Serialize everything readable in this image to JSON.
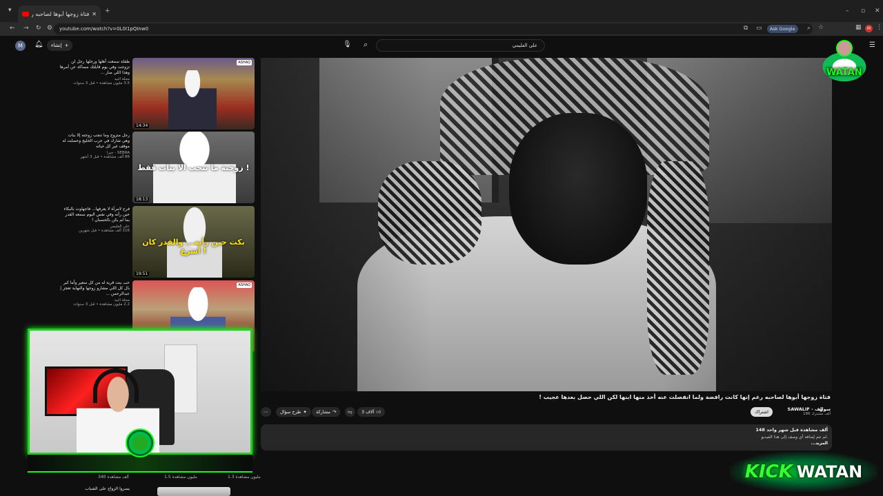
{
  "browser": {
    "tab_title": "فتاة زوجها أبوها لصاحبه رغم",
    "url": "youtube.com/watch?v=0L0I1pQInw0",
    "ask_google": "Ask Google",
    "profile_letter": "M"
  },
  "youtube": {
    "create_label": "إنشاء",
    "search_value": "علي العليمي",
    "avatar_letter": "M"
  },
  "video": {
    "title": "فتاة زوجها أبوها لصاحبه رغم إنها كانت رافضة ولما انفصلت عنه أخذ منها ابنها لكن اللي حصل بعدها عجيب !",
    "channel": "SAWALIF - سوالف",
    "subscribers": "186 ألف مشترك",
    "subscribe_label": "اشتراك",
    "likes": "3 آلاف",
    "share_label": "مشاركة",
    "ask_label": "طرح سؤال",
    "views_date": "148 ألف مشاهدة قبل شهر واحد",
    "desc_line1": "لم تتم إضافة أي وصف إلى هذا الفيديو.",
    "desc_more": "...المزيد"
  },
  "sidebar": [
    {
      "title": "طفلة سمعت أهلها ورجلها رجل لن تزوجت وفي يوم قابلتك مساكة عن أمرها وهذا اللي صار ...",
      "channel": "مجلة البيد",
      "stats": "3.5 مليون مشاهدة • قبل 3 سنوات",
      "duration": "14:34",
      "caption": "",
      "caption_style": "none"
    },
    {
      "title": "رجل متزوج وما تنجب زوجته إلا بنات وهي شارك في حرب الخليج وحصلت له موقف غير كل حياته",
      "channel": "SEBRA - جبرا",
      "stats": "86 ألف مشاهدة • قبل 3 أشهر",
      "duration": "18:13",
      "caption": "زوجتة ما تنجب الا بنات فقط !",
      "caption_style": "white"
    },
    {
      "title": "فرح لامرأة لا يعرفها... فاجهاوت بالبكاء حين رأته وفي نفس اليوم سمعه القدر بما لم يكن بالحسبان !",
      "channel": "علي العليمي",
      "stats": "116 ألف مشاهدة • قبل شهرين",
      "duration": "19:51",
      "caption": "بكت حين رأته... والقدر كان أسرع !",
      "caption_style": "yellow"
    },
    {
      "title": "حب بنت قرية له من كل سعير وأما كبر بال كل اللي مشارو زوجها والنهاية تعجز | عبدالرحمن ...",
      "channel": "مجلة البيد",
      "stats": "2.2 مليون مشاهدة • قبل 3 سنوات",
      "duration": "",
      "caption": "",
      "caption_style": "none"
    }
  ],
  "bottom_stats": [
    "1.3 مليون مشاهدة",
    "1.5 مليون مشاهدة",
    "340 ألف مشاهدة"
  ],
  "bottom_title": "يسروا الزواج على الشباب",
  "overlay": {
    "kick": "KICK",
    "watan": "WATAN",
    "top_logo": "WATAN"
  },
  "colors": {
    "accent_green": "#1aff1a",
    "yt_red": "#ff0000",
    "bg": "#0f0f0f"
  }
}
